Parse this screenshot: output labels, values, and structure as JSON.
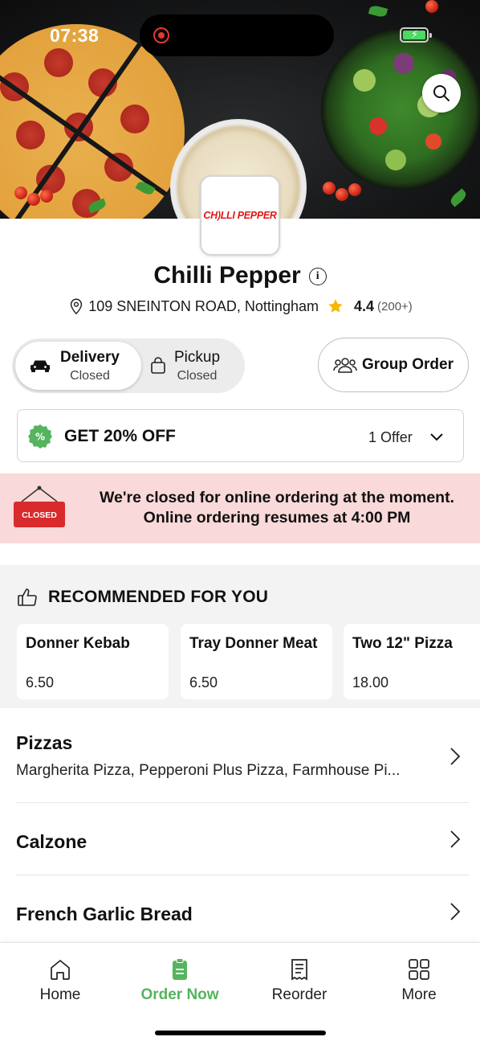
{
  "status_bar": {
    "time": "07:38"
  },
  "logo": {
    "text": "CH)LLI PEPPER"
  },
  "restaurant": {
    "name": "Chilli Pepper",
    "address": "109 SNEINTON ROAD, Nottingham",
    "rating": "4.4",
    "rating_count": "(200+)"
  },
  "modes": {
    "delivery": {
      "label": "Delivery",
      "status": "Closed"
    },
    "pickup": {
      "label": "Pickup",
      "status": "Closed"
    }
  },
  "group_order": {
    "label": "Group Order"
  },
  "offer": {
    "title": "GET 20% OFF",
    "count": "1 Offer"
  },
  "closed_banner": {
    "sign_text": "CLOSED",
    "line1": "We're closed for online ordering at the moment.",
    "line2": "Online ordering resumes at 4:00 PM"
  },
  "recommended": {
    "heading": "RECOMMENDED FOR YOU",
    "items": [
      {
        "name": "Donner Kebab",
        "price": "6.50"
      },
      {
        "name": "Tray Donner Meat",
        "price": "6.50"
      },
      {
        "name": "Two 12\" Pizza",
        "price": "18.00"
      }
    ]
  },
  "categories": [
    {
      "name": "Pizzas",
      "description": "Margherita Pizza, Pepperoni Plus Pizza, Farmhouse Pi..."
    },
    {
      "name": "Calzone"
    },
    {
      "name": "French Garlic Bread"
    }
  ],
  "tabs": [
    {
      "label": "Home"
    },
    {
      "label": "Order Now"
    },
    {
      "label": "Reorder"
    },
    {
      "label": "More"
    }
  ],
  "colors": {
    "accent_green": "#55b45d",
    "closed_banner_bg": "#f9d9d9",
    "closed_sign_red": "#d92b2b",
    "star_gold": "#f2b800",
    "logo_red": "#e01818"
  }
}
